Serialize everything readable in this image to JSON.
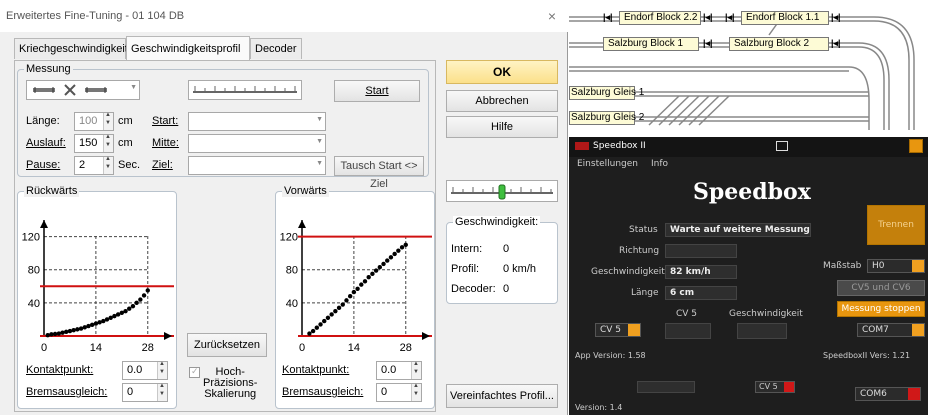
{
  "dialog": {
    "title": "Erweitertes Fine-Tuning - 01 104 DB",
    "close": "×",
    "tabs": [
      "Kriechgeschwindigkeit",
      "Geschwindigkeitsprofil",
      "Decoder"
    ],
    "active_tab": "Geschwindigkeitsprofil",
    "messung": {
      "legend": "Messung",
      "start_button": "Start",
      "laenge_label": "Länge:",
      "laenge_value": "100",
      "auslauf_label": "Auslauf:",
      "auslauf_value": "150",
      "pause_label": "Pause:",
      "pause_value": "2",
      "unit_cm": "cm",
      "unit_sec": "Sec.",
      "start_label": "Start:",
      "mitte_label": "Mitte:",
      "ziel_label": "Ziel:",
      "tausch_button": "Tausch Start <> Ziel"
    },
    "rueckwaerts": {
      "legend": "Rückwärts",
      "kontaktpunkt_label": "Kontaktpunkt:",
      "kontaktpunkt_value": "0.0",
      "bremsausgleich_label": "Bremsausgleich:",
      "bremsausgleich_value": "0"
    },
    "vorwaerts": {
      "legend": "Vorwärts",
      "kontaktpunkt_label": "Kontaktpunkt:",
      "kontaktpunkt_value": "0.0",
      "bremsausgleich_label": "Bremsausgleich:",
      "bremsausgleich_value": "0"
    },
    "zuruecksetzen_button": "Zurücksetzen",
    "hochpraezision_label": "Hoch-\nPräzisions-\nSkalierung",
    "buttons": {
      "ok": "OK",
      "abbrechen": "Abbrechen",
      "hilfe": "Hilfe",
      "vereinfachtes": "Vereinfachtes Profil..."
    },
    "geschwindigkeit": {
      "legend": "Geschwindigkeit:",
      "intern_label": "Intern:",
      "intern_value": "0",
      "profil_label": "Profil:",
      "profil_value": "0 km/h",
      "decoder_label": "Decoder:",
      "decoder_value": "0"
    }
  },
  "chart_data": [
    {
      "type": "scatter",
      "title": "Rückwärts",
      "x_ticks": [
        "0",
        "14",
        "28"
      ],
      "y_ticks": [
        "40",
        "80",
        "120"
      ],
      "xlim": [
        0,
        34
      ],
      "ylim": [
        0,
        140
      ],
      "red_lines": [
        60,
        0
      ],
      "x": [
        1,
        2,
        3,
        4,
        5,
        6,
        7,
        8,
        9,
        10,
        11,
        12,
        13,
        14,
        15,
        16,
        17,
        18,
        19,
        20,
        21,
        22,
        23,
        24,
        25,
        26,
        27,
        28
      ],
      "y": [
        1,
        2,
        2.5,
        3,
        4,
        5,
        6,
        7,
        8,
        9,
        10.5,
        12,
        13.5,
        15,
        16.5,
        18,
        20,
        22,
        24,
        26,
        28,
        30,
        33,
        36,
        40,
        44,
        49,
        55
      ]
    },
    {
      "type": "scatter",
      "title": "Vorwärts",
      "x_ticks": [
        "0",
        "14",
        "28"
      ],
      "y_ticks": [
        "40",
        "80",
        "120"
      ],
      "xlim": [
        0,
        34
      ],
      "ylim": [
        0,
        140
      ],
      "red_lines": [
        120,
        0
      ],
      "x": [
        2,
        3,
        4,
        5,
        6,
        7,
        8,
        9,
        10,
        11,
        12,
        13,
        14,
        15,
        16,
        17,
        18,
        19,
        20,
        21,
        22,
        23,
        24,
        25,
        26,
        27,
        28
      ],
      "y": [
        3,
        6,
        10,
        14,
        18,
        22,
        26,
        30,
        34,
        38,
        43,
        48,
        53,
        57,
        62,
        66,
        71,
        75,
        79,
        83,
        87,
        91,
        95,
        99,
        103,
        107,
        110
      ]
    }
  ],
  "layout": {
    "blocks": [
      {
        "label": "Endorf Block 2.2"
      },
      {
        "label": "Endorf Block 1.1"
      },
      {
        "label": "Salzburg Block 1"
      },
      {
        "label": "Salzburg Block 2"
      },
      {
        "label": "Salzburg Gleis 1"
      },
      {
        "label": "Salzburg Gleis 2"
      }
    ],
    "sym": "|◂|"
  },
  "speedbox": {
    "title": "Speedbox II",
    "menu": [
      "Einstellungen",
      "Info"
    ],
    "heading": "Speedbox",
    "status_label": "Status",
    "status_value": "Warte auf weitere Messung",
    "richtung_label": "Richtung",
    "richtung_value": "",
    "geschwindigkeit_label": "Geschwindigkeit",
    "geschwindigkeit_value": "82 km/h",
    "laenge_label": "Länge",
    "laenge_value": "6 cm",
    "trennen_button": "Trennen",
    "massstab_label": "Maßstab",
    "massstab_value": "H0",
    "cv5cv6_button": "CV5 und CV6",
    "messung_stoppen_button": "Messung stoppen",
    "cv5_label": "CV 5",
    "cv_geschwindigkeit_label": "Geschwindigkeit",
    "cv_select": "CV 5",
    "com_select": "COM7",
    "app_version": "App Version: 1.58",
    "speedbox_version": "SpeedboxII Vers: 1.21",
    "behind_com": "COM6",
    "behind_cv": "CV 5",
    "behind_version": "Version: 1.4"
  },
  "colors": {
    "accent_orange": "#e8960f",
    "ok_yellow": "#fbe08a",
    "chart_red": "#d01010"
  }
}
